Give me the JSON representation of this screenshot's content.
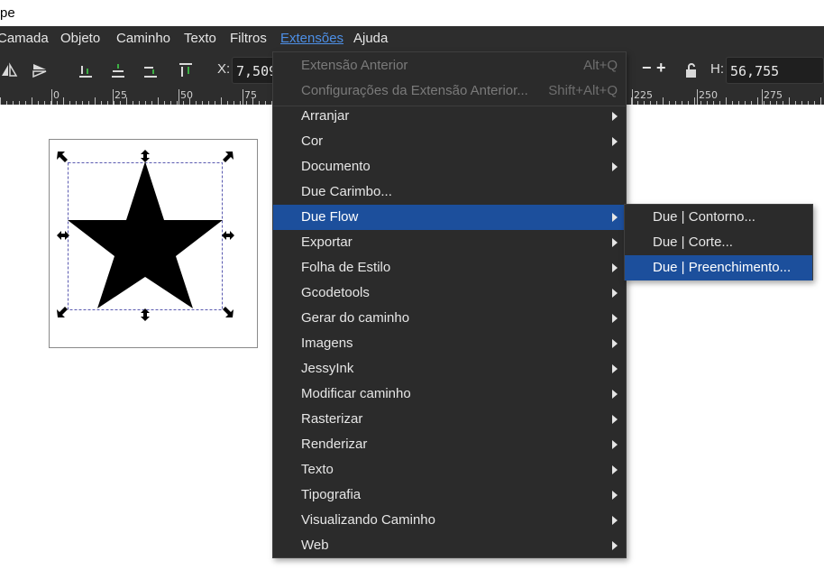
{
  "window": {
    "title_fragment": "pe"
  },
  "menubar": {
    "items": [
      {
        "label": "Camada"
      },
      {
        "label": "Objeto"
      },
      {
        "label": "Caminho"
      },
      {
        "label": "Texto"
      },
      {
        "label": "Filtros"
      },
      {
        "label": "Extensões",
        "active": true
      },
      {
        "label": "Ajuda"
      }
    ]
  },
  "toolbar": {
    "x_label": "X:",
    "x_value": "7,509",
    "h_label": "H:",
    "h_value": "56,755",
    "minus": "−",
    "plus": "+",
    "icons": [
      "flip-horizontal-icon",
      "flip-vertical-icon",
      "align-bottom-icon",
      "align-middle-icon",
      "raise-icon",
      "align-top-icon",
      "lock-icon"
    ]
  },
  "ruler": {
    "labels": [
      "0",
      "25",
      "50",
      "75",
      "225",
      "250",
      "275"
    ]
  },
  "extensions_menu": {
    "items": [
      {
        "label": "Extensão Anterior",
        "shortcut": "Alt+Q",
        "disabled": true
      },
      {
        "label": "Configurações da Extensão Anterior...",
        "shortcut": "Shift+Alt+Q",
        "disabled": true
      },
      {
        "label": "Arranjar",
        "submenu": true
      },
      {
        "label": "Cor",
        "submenu": true
      },
      {
        "label": "Documento",
        "submenu": true
      },
      {
        "label": "Due Carimbo..."
      },
      {
        "label": "Due Flow",
        "submenu": true,
        "highlighted": true
      },
      {
        "label": "Exportar",
        "submenu": true
      },
      {
        "label": "Folha de Estilo",
        "submenu": true
      },
      {
        "label": "Gcodetools",
        "submenu": true
      },
      {
        "label": "Gerar do caminho",
        "submenu": true
      },
      {
        "label": "Imagens",
        "submenu": true
      },
      {
        "label": "JessyInk",
        "submenu": true
      },
      {
        "label": "Modificar caminho",
        "submenu": true
      },
      {
        "label": "Rasterizar",
        "submenu": true
      },
      {
        "label": "Renderizar",
        "submenu": true
      },
      {
        "label": "Texto",
        "submenu": true
      },
      {
        "label": "Tipografia",
        "submenu": true
      },
      {
        "label": "Visualizando Caminho",
        "submenu": true
      },
      {
        "label": "Web",
        "submenu": true
      }
    ]
  },
  "due_flow_submenu": {
    "items": [
      {
        "label": "Due | Contorno..."
      },
      {
        "label": "Due | Corte..."
      },
      {
        "label": "Due | Preenchimento...",
        "highlighted": true
      }
    ]
  },
  "colors": {
    "menu_bg": "#2b2b2b",
    "highlight": "#1c4f9c",
    "active_menu_text": "#4d8fe6",
    "canvas": "#ffffff"
  }
}
